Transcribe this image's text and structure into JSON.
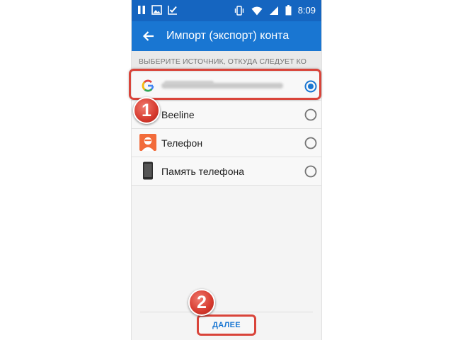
{
  "status_bar": {
    "time": "8:09",
    "left_icons": [
      "pause-icon",
      "image-icon",
      "check-icon"
    ],
    "right_icons": [
      "vibrate-icon",
      "wifi-icon",
      "signal-icon",
      "battery-icon"
    ]
  },
  "app_bar": {
    "back_icon": "arrow-left-icon",
    "title": "Импорт (экспорт) конта"
  },
  "section_header": "ВЫБЕРИТЕ ИСТОЧНИК, ОТКУДА СЛЕДУЕТ КО",
  "sources": [
    {
      "label": "",
      "icon": "google-icon",
      "selected": true
    },
    {
      "label": "Beeline",
      "icon": "",
      "selected": false
    },
    {
      "label": "Телефон",
      "icon": "person-icon",
      "selected": false
    },
    {
      "label": "Память телефона",
      "icon": "phone-icon",
      "selected": false
    }
  ],
  "annotations": {
    "step1": "1",
    "step2": "2"
  },
  "footer": {
    "next_label": "ДАЛЕЕ"
  },
  "colors": {
    "status_bar": "#1565c0",
    "app_bar": "#1976d2",
    "accent": "#1976d2",
    "highlight": "#d9443a",
    "person_icon_bg": "#f26b3a"
  }
}
